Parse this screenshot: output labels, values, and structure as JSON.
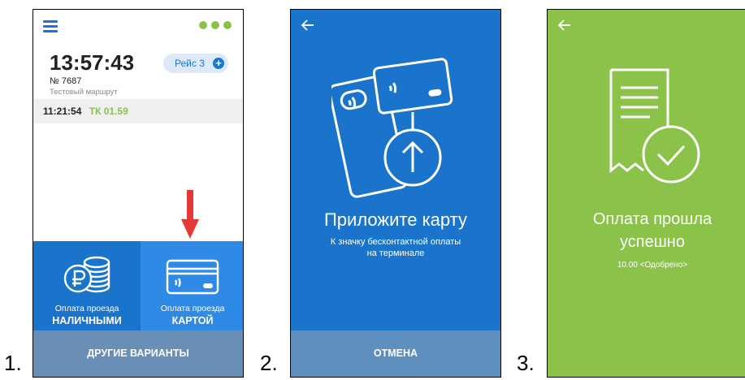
{
  "steps": [
    "1.",
    "2.",
    "3."
  ],
  "screen1": {
    "clock": "13:57:43",
    "trip_badge": "Рейс 3",
    "trip_plus": "+",
    "vehicle": "№ 7687",
    "route": "Тестовый маршрут",
    "log": {
      "time": "11:21:54",
      "code": "ТК 01.59"
    },
    "cash": {
      "small": "Оплата проезда",
      "big": "НАЛИЧНЫМИ"
    },
    "card": {
      "small": "Оплата проезда",
      "big": "КАРТОЙ"
    },
    "bottom_button": "ДРУГИЕ ВАРИАНТЫ"
  },
  "screen2": {
    "title": "Приложите карту",
    "subtitle_line1": "К значку бесконтактной оплаты",
    "subtitle_line2": "на терминале",
    "bottom_button": "ОТМЕНА"
  },
  "screen3": {
    "title_line1": "Оплата прошла",
    "title_line2": "успешно",
    "status": "10.00 <Одобрено>"
  },
  "colors": {
    "primary_blue": "#1a74cc",
    "card_blue": "#2f8ae5",
    "success_green": "#8bc34a",
    "arrow_red": "#e53935"
  },
  "icons": [
    "menu-icon",
    "more-dots-icon",
    "plus-icon",
    "down-arrow-icon",
    "coins-ruble-icon",
    "card-contactless-icon",
    "back-arrow-icon",
    "tap-card-terminal-icon",
    "receipt-check-icon"
  ]
}
